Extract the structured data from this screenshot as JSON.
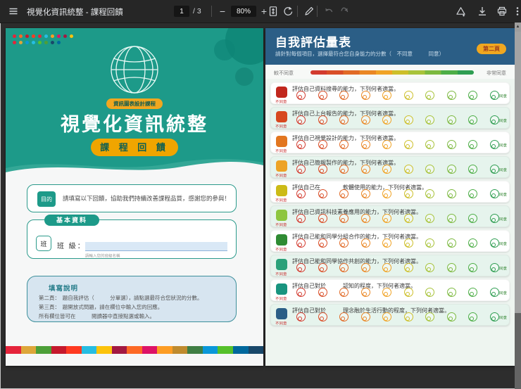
{
  "toolbar": {
    "title": "視覺化資訊統整 - 課程回饋",
    "page_current": "1",
    "page_total": "/ 3",
    "minus": "−",
    "zoom_value": "80%",
    "plus": "+"
  },
  "scrollbar": {
    "up_arrow": "▲"
  },
  "cover": {
    "dot_colors": [
      "#e5243b",
      "#fd6925",
      "#c5192d",
      "#ff3a21",
      "#e5243b",
      "#26bde2",
      "#fd9d24",
      "#dd1367",
      "#a21942",
      "#fcc30b",
      "#e5243b",
      "#dda63a",
      "#0a97d9",
      "#26bde2",
      "#56c02b",
      "#4c9f38",
      "#19486a",
      "#00689d"
    ],
    "course_pill": "資訊圖表設計課程",
    "title": "視覺化資訊統整",
    "button": "課 程 回 饋",
    "purpose": {
      "badge": "目的",
      "text": "請填寫以下回饋，協助我們持續改善課程品質，感謝您的參與！"
    },
    "basic": {
      "header": "基本資料",
      "square": "班",
      "label": "班 級：",
      "placeholder": "請輸入您的班級名稱"
    },
    "instructions": {
      "title": "填寫說明",
      "lines": [
        "第二頁：　題自我評估（　　　分單選），請點選最符合您狀況的分數。",
        "第三頁：　題開放式問題，請在欄位中輸入您的回應。",
        "所有欄位皆可在　　　閱讀器中直接點選或輸入。"
      ]
    },
    "stripe_colors": [
      "#e5243b",
      "#dda63a",
      "#4c9f38",
      "#c5192d",
      "#ff3a21",
      "#26bde2",
      "#fcc30b",
      "#a21942",
      "#fd6925",
      "#dd1367",
      "#fd9d24",
      "#bf8b2e",
      "#3f7e44",
      "#0a97d9",
      "#56c02b",
      "#00689d",
      "#19486a"
    ]
  },
  "survey": {
    "title": "自我評估量表",
    "subtitle": "請針對每個項目，選擇最符合您自身能力的分數（　不同意　　　同意）",
    "page_pill": "第二頁",
    "legend_left": "較不同意",
    "legend_right": "非常同意",
    "row_left_label": "不同意",
    "row_right_label": "同意",
    "option_colors": [
      "#d33b2f",
      "#d94e28",
      "#e16a26",
      "#ea8724",
      "#f0a325",
      "#cdbf2a",
      "#a8c33a",
      "#7cb93f",
      "#4dae47",
      "#2f9e52"
    ],
    "row_alt_color": "#e6f4ed",
    "questions": [
      {
        "color": "#c1271d",
        "text": "評估自己資料搜尋的能力，下列何者適當。"
      },
      {
        "color": "#d7481f",
        "text": "評估自己上台報告的能力，下列何者適當。"
      },
      {
        "color": "#e2761f",
        "text": "評估自己視覺設計的能力，下列何者適當。"
      },
      {
        "color": "#eda324",
        "text": "評估自己簡報製作的能力，下列何者適當。"
      },
      {
        "color": "#ccbb17",
        "text": "評估自己在　　　　軟體使用的能力，下列何者適當。"
      },
      {
        "color": "#8dc63f",
        "text": "評估自己資訊科技素養應用的能力，下列何者適當。"
      },
      {
        "color": "#2f8b33",
        "text": "評估自己能和同學分組合作的能力，下列何者適當。"
      },
      {
        "color": "#2aa179",
        "text": "評估自己能和同學協作共創的能力，下列何者適當。"
      },
      {
        "color": "#19947f",
        "text": "評估自己對於　　　認知的程度，下列何者適當。"
      },
      {
        "color": "#2b5e86",
        "text": "評估自己對於　　　理念融於生活行動的程度，下列何者適當。"
      }
    ]
  }
}
